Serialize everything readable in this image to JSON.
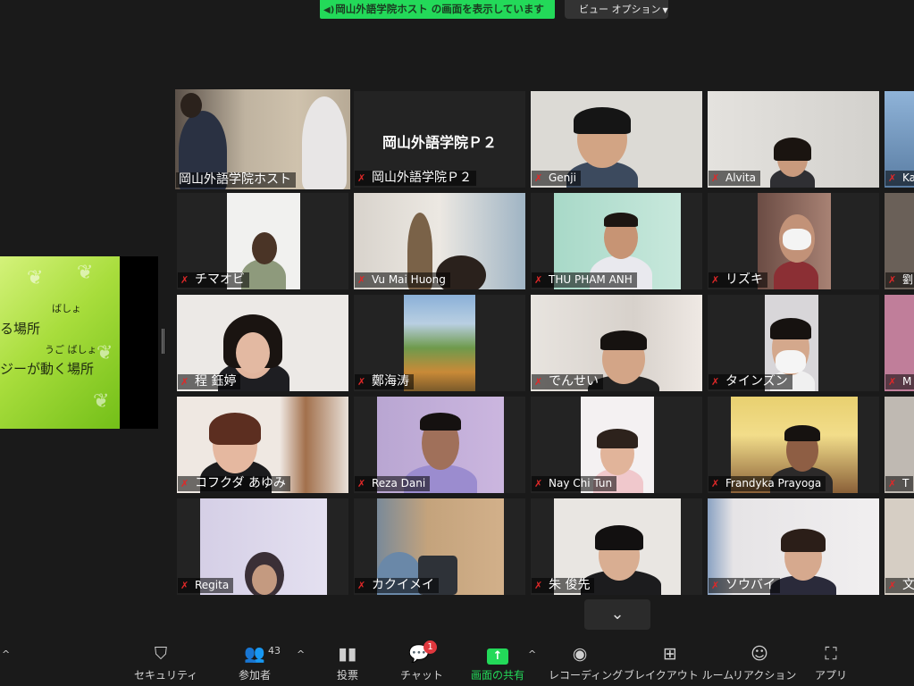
{
  "banner": {
    "sharing_text": "岡山外語学院ホスト の画面を表示しています",
    "view_options": "ビュー オプション"
  },
  "shared_slide": {
    "ruby1": "ばしょ",
    "line1": "る場所",
    "ruby2": "うご  ばしょ",
    "line2": "ジーが動く場所"
  },
  "participants": [
    {
      "name": "岡山外語学院ホスト",
      "muted": false,
      "active": true
    },
    {
      "name": "岡山外語学院Ｐ２",
      "muted": true,
      "center_label": "岡山外語学院Ｐ２"
    },
    {
      "name": "Genji",
      "muted": true
    },
    {
      "name": "Alvita",
      "muted": true
    },
    {
      "name": "Ka",
      "muted": true
    },
    {
      "name": "チマオビ",
      "muted": true
    },
    {
      "name": "Vu Mai Huong",
      "muted": true
    },
    {
      "name": "THU PHAM ANH",
      "muted": true
    },
    {
      "name": "リズキ",
      "muted": true
    },
    {
      "name": "劉",
      "muted": true
    },
    {
      "name": "程 鈺婷",
      "muted": true
    },
    {
      "name": "鄭海涛",
      "muted": true
    },
    {
      "name": "でんせい",
      "muted": true
    },
    {
      "name": "タインズン",
      "muted": true
    },
    {
      "name": "M",
      "muted": true
    },
    {
      "name": "コフクダ  あゆみ",
      "muted": true
    },
    {
      "name": "Reza Dani",
      "muted": true
    },
    {
      "name": "Nay Chi Tun",
      "muted": true
    },
    {
      "name": "Frandyka Prayoga",
      "muted": true
    },
    {
      "name": "T",
      "muted": true
    },
    {
      "name": "Regita",
      "muted": true
    },
    {
      "name": "カクイメイ",
      "muted": true
    },
    {
      "name": "朱 俊先",
      "muted": true
    },
    {
      "name": "ソウバイ",
      "muted": true
    },
    {
      "name": "文",
      "muted": true
    }
  ],
  "toolbar": {
    "security": "セキュリティ",
    "participants": "参加者",
    "participant_count": "43",
    "polls": "投票",
    "chat": "チャット",
    "chat_badge": "1",
    "share": "画面の共有",
    "record": "レコーディング",
    "breakout": "ブレイクアウト ルーム",
    "reactions": "リアクション",
    "apps": "アプリ"
  },
  "colors": {
    "share_green": "#23d959",
    "active_outline": "#f3ef8c",
    "muted_red": "#e02828"
  }
}
